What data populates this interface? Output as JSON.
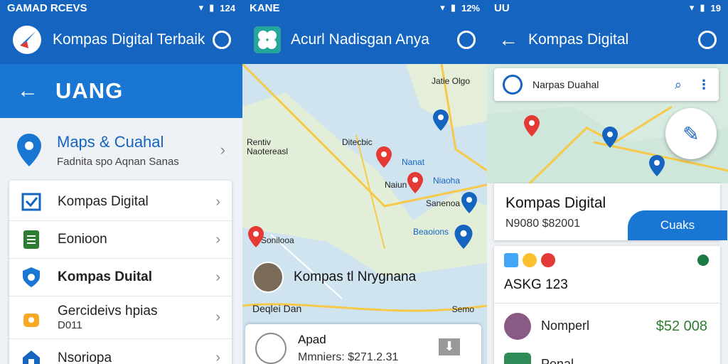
{
  "panel1": {
    "status": {
      "left": "GAMAD RCEVS",
      "right": "124"
    },
    "appbar": {
      "title": "Kompas Digital Terbaik"
    },
    "header": {
      "title": "UANG"
    },
    "maps_row": {
      "title": "Maps & Cuahal",
      "subtitle": "Fadnita spo Aqnan  Sanas"
    },
    "menu": [
      {
        "label": "Kompas Digital",
        "sub": "",
        "icon": "check-mail-icon",
        "bold": false
      },
      {
        "label": "Eonioon",
        "sub": "",
        "icon": "sheet-icon",
        "bold": false
      },
      {
        "label": "Kompas Duital",
        "sub": "",
        "icon": "shield-icon",
        "bold": true
      },
      {
        "label": "Gercideivs hpias",
        "sub": "D011",
        "icon": "lock-icon",
        "bold": false
      },
      {
        "label": "Nsoriopa",
        "sub": "",
        "icon": "home-icon",
        "bold": false
      }
    ]
  },
  "panel2": {
    "status": {
      "left": "KANE",
      "right": "12%"
    },
    "appbar": {
      "title": "Acurl Nadisgan Anya"
    },
    "map_labels": [
      "Jatie Olgo",
      "Rentiv Naotereasl",
      "Ditecbic",
      "Nanat",
      "Naiun",
      "Niaoha",
      "Sanenoa",
      "Sonilooa",
      "Beaoions"
    ],
    "place": {
      "title": "Kompas tl Nrygnana"
    },
    "scale_left": "Deqlei  Dan",
    "scale_right": "Semo",
    "card": {
      "title": "Apad",
      "subtitle": "Mmniers: $271.2.31"
    }
  },
  "panel3": {
    "status": {
      "left": "UU",
      "right": "19"
    },
    "appbar": {
      "title": "Kompas Digital"
    },
    "search": {
      "text": "Narpas Duahal"
    },
    "info": {
      "title": "Kompas Digital",
      "code": "N9080 $82001",
      "cta": "Cuaks"
    },
    "list": {
      "heading": "ASKG  123",
      "rows": [
        {
          "name": "Nomperl",
          "amount": "$52 008"
        },
        {
          "name": "Penal",
          "amount": ""
        }
      ]
    }
  },
  "colors": {
    "primary": "#1565c0",
    "accent": "#1976d2",
    "green": "#2e7d32"
  }
}
